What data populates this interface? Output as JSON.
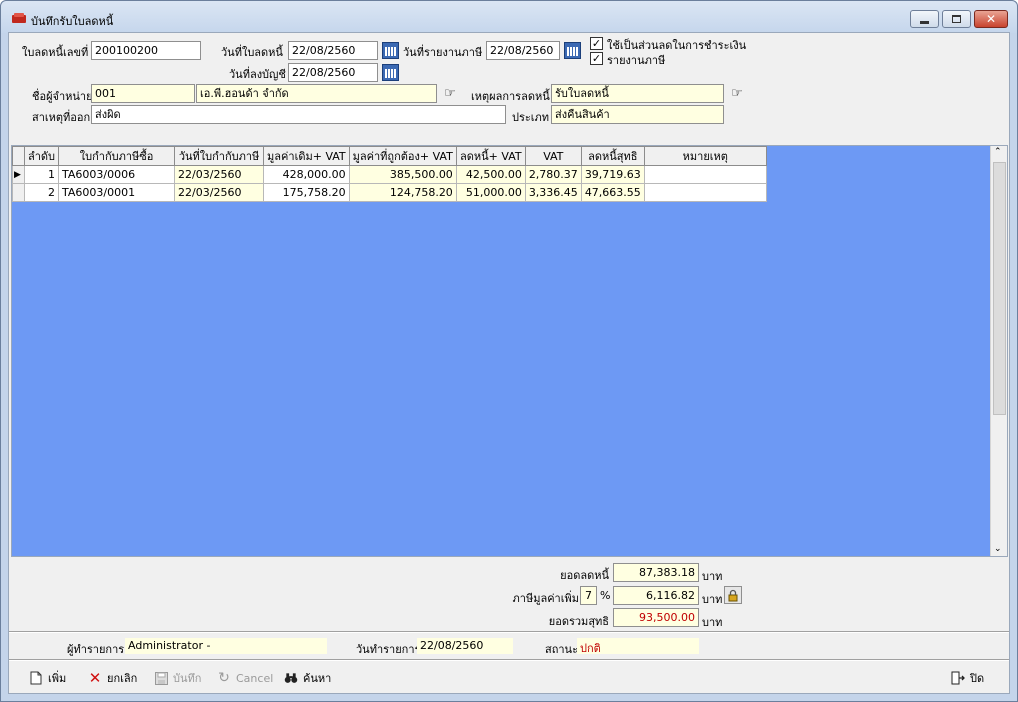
{
  "window": {
    "title": "บันทึกรับใบลดหนี้"
  },
  "header": {
    "doc_no_label": "ใบลดหนี้เลขที่",
    "doc_no": "200100200",
    "doc_date_label": "วันที่ใบลดหนี้",
    "doc_date": "22/08/2560",
    "tax_report_date_label": "วันที่รายงานภาษี",
    "tax_report_date": "22/08/2560",
    "account_date_label": "วันที่ลงบัญชี",
    "account_date": "22/08/2560",
    "check_payment_label": "ใช้เป็นส่วนลดในการชำระเงิน",
    "check_tax_report_label": "รายงานภาษี",
    "vendor_label": "ชื่อผู้จำหน่าย",
    "vendor_code": "001",
    "vendor_name": "เอ.พี.ฮอนด้า จำกัด",
    "reason_label": "เหตุผลการลดหนี้",
    "reason": "รับใบลดหนี้",
    "cause_label": "สาเหตุที่ออก",
    "cause": "ส่งผิด",
    "type_label": "ประเภท",
    "type": "ส่งคืนสินค้า"
  },
  "grid": {
    "columns": [
      "ลำดับ",
      "ใบกำกับภาษีซื้อ",
      "วันที่ใบกำกับภาษี",
      "มูลค่าเดิม+ VAT",
      "มูลค่าที่ถูกต้อง+ VAT",
      "ลดหนี้+ VAT",
      "VAT",
      "ลดหนี้สุทธิ",
      "หมายเหตุ"
    ],
    "rows": [
      {
        "no": "1",
        "invoice": "TA6003/0006",
        "date": "22/03/2560",
        "orig": "428,000.00",
        "correct": "385,500.00",
        "credit": "42,500.00",
        "vat": "2,780.37",
        "net": "39,719.63",
        "note": ""
      },
      {
        "no": "2",
        "invoice": "TA6003/0001",
        "date": "22/03/2560",
        "orig": "175,758.20",
        "correct": "124,758.20",
        "credit": "51,000.00",
        "vat": "3,336.45",
        "net": "47,663.55",
        "note": ""
      }
    ]
  },
  "summary": {
    "credit_total_label": "ยอดลดหนี้",
    "credit_total": "87,383.18",
    "vat_label": "ภาษีมูลค่าเพิ่ม",
    "vat_rate": "7",
    "percent_sign": "%",
    "vat_amount": "6,116.82",
    "net_label": "ยอดรวมสุทธิ",
    "net_total": "93,500.00",
    "currency": "บาท"
  },
  "status": {
    "operator_label": "ผู้ทำรายการ",
    "operator": "Administrator -",
    "txn_date_label": "วันทำรายการ",
    "txn_date": "22/08/2560",
    "state_label": "สถานะ",
    "state": "ปกติ"
  },
  "toolbar": {
    "add": "เพิ่ม",
    "cancel_doc": "ยกเลิก",
    "save": "บันทึก",
    "cancel": "Cancel",
    "search": "ค้นหา",
    "close": "ปิด"
  },
  "colors": {
    "grid_bg": "#6d99f4",
    "state_text": "#c00000",
    "net_text": "#c00000"
  }
}
